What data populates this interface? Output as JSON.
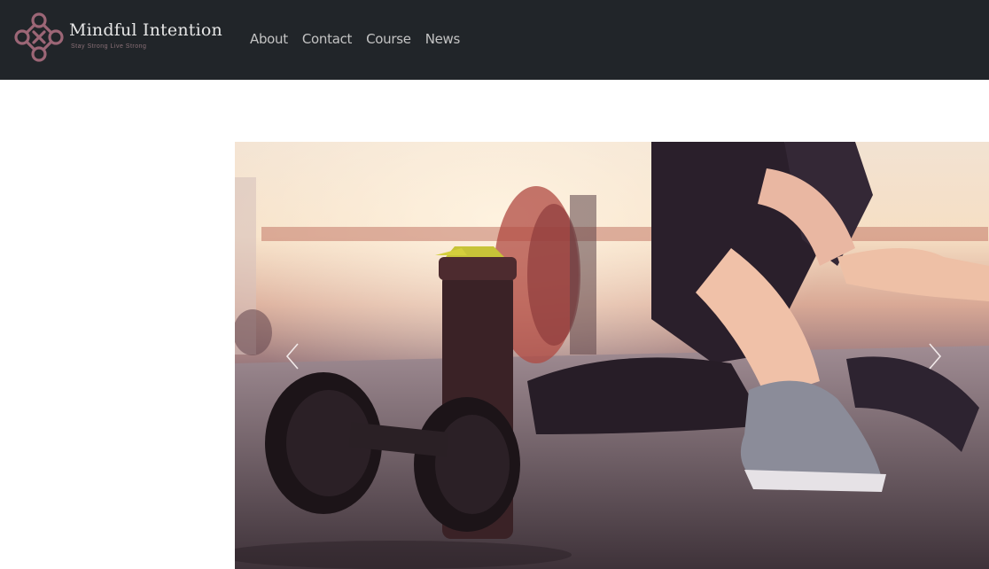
{
  "brand": {
    "name": "Mindful Intention",
    "tagline": "Stay Strong Live Strong",
    "logo_icon": "quatrefoil-knot-icon",
    "accent_color": "#9c6676"
  },
  "nav": {
    "items": [
      {
        "label": "About"
      },
      {
        "label": "Contact"
      },
      {
        "label": "Course"
      },
      {
        "label": "News"
      }
    ]
  },
  "carousel": {
    "prev_icon": "chevron-left-icon",
    "next_icon": "chevron-right-icon",
    "slide_icon": "fitness-photo"
  },
  "colors": {
    "navbar_bg": "#212529",
    "nav_link": "#c3c3c3",
    "page_bg": "#ffffff"
  }
}
